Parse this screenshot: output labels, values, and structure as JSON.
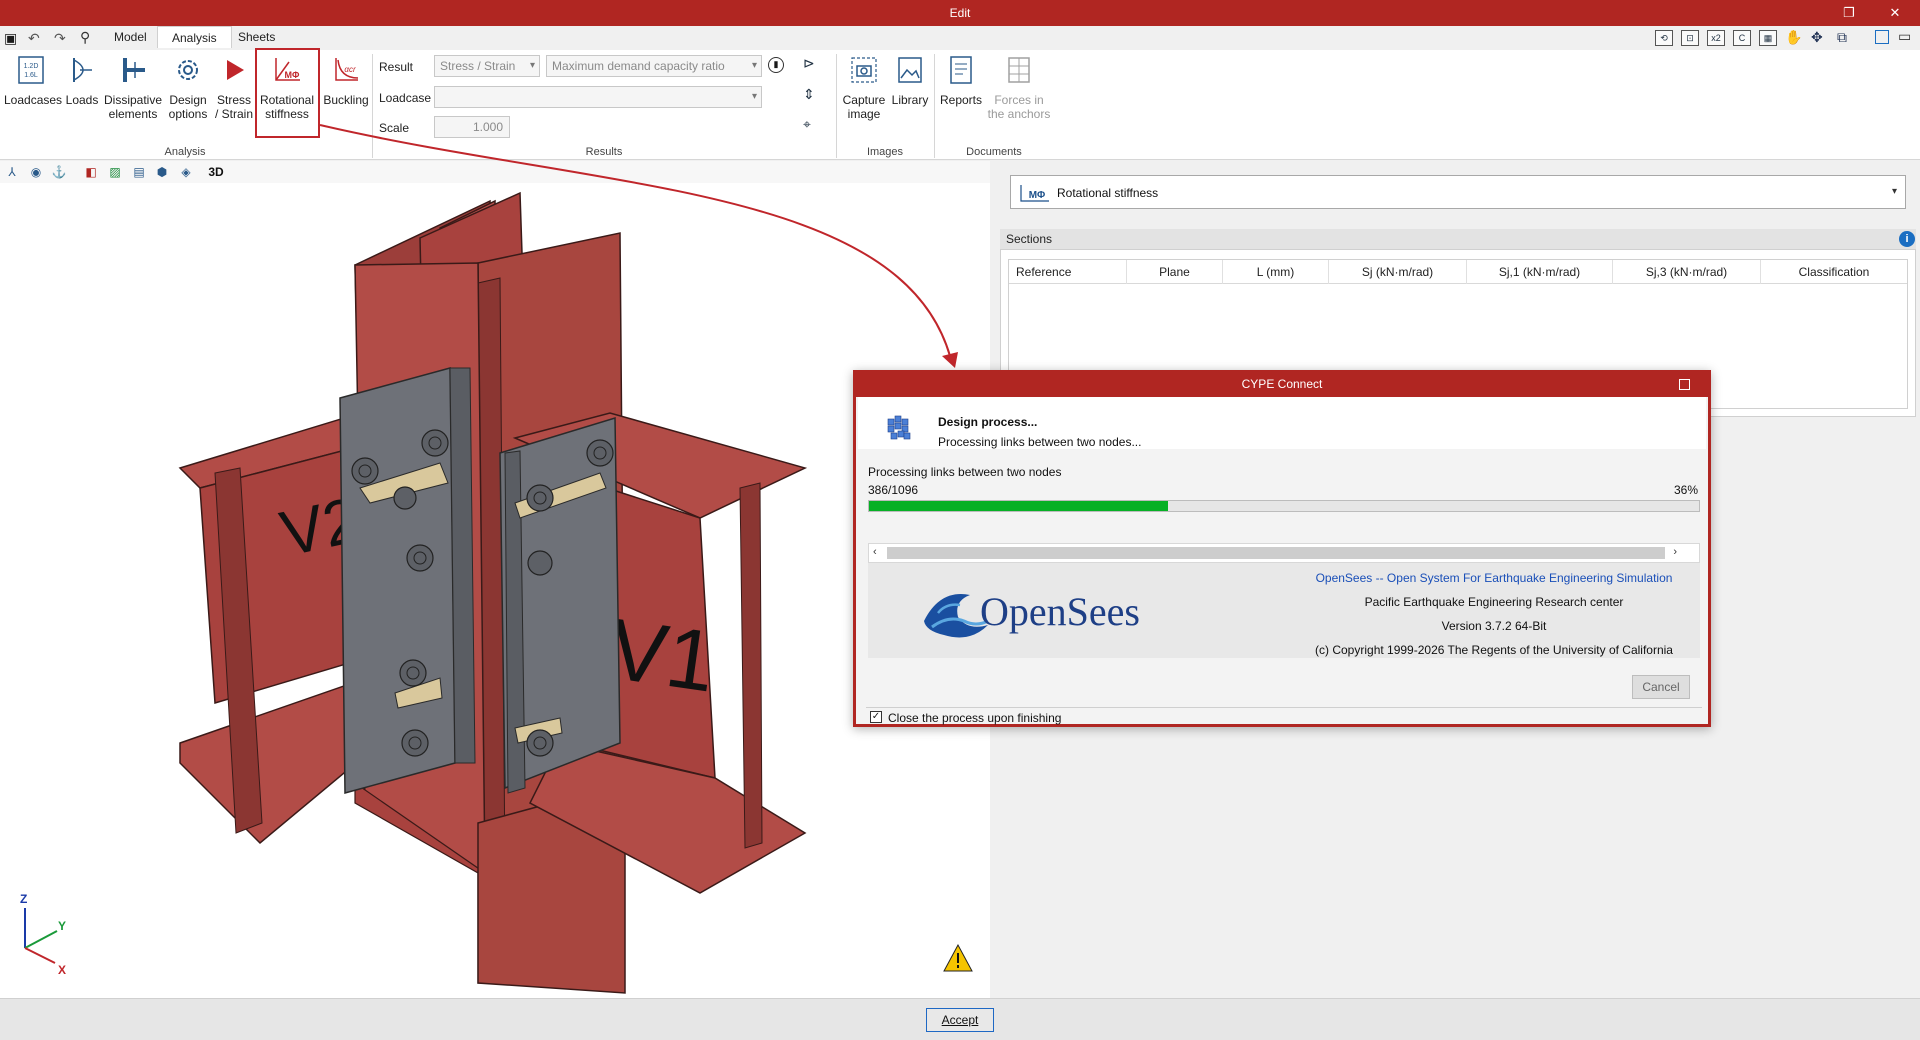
{
  "window": {
    "title": "Edit"
  },
  "tabs": [
    {
      "label": "Model"
    },
    {
      "label": "Analysis"
    },
    {
      "label": "Sheets"
    }
  ],
  "ribbon": {
    "analysis_group": {
      "label": "Analysis",
      "buttons": [
        {
          "label1": "Loadcases",
          "label2": ""
        },
        {
          "label1": "Loads",
          "label2": ""
        },
        {
          "label1": "Dissipative",
          "label2": "elements"
        },
        {
          "label1": "Design",
          "label2": "options"
        },
        {
          "label1": "Stress",
          "label2": "/ Strain"
        },
        {
          "label1": "Rotational",
          "label2": "stiffness"
        },
        {
          "label1": "Buckling",
          "label2": ""
        }
      ]
    },
    "results_group": {
      "label": "Results",
      "result_label": "Result",
      "result_value": "Stress / Strain",
      "result_mode": "Maximum demand capacity ratio",
      "loadcase_label": "Loadcase",
      "loadcase_value": "",
      "scale_label": "Scale",
      "scale_value": "1.000"
    },
    "images_group": {
      "label": "Images",
      "buttons": [
        {
          "label1": "Capture",
          "label2": "image"
        },
        {
          "label1": "Library",
          "label2": ""
        }
      ]
    },
    "documents_group": {
      "label": "Documents",
      "buttons": [
        {
          "label1": "Reports",
          "label2": ""
        },
        {
          "label1": "Forces in",
          "label2": "the anchors"
        }
      ]
    }
  },
  "viewport": {
    "beam_labels": [
      "V2",
      "V1"
    ],
    "axes": {
      "z": "Z",
      "y": "Y",
      "x": "X"
    },
    "toolbar_3d": "3D"
  },
  "right_panel": {
    "selector_value": "Rotational stiffness",
    "sections_title": "Sections",
    "columns": [
      "Reference",
      "Plane",
      "L (mm)",
      "Sj (kN·m/rad)",
      "Sj,1 (kN·m/rad)",
      "Sj,3 (kN·m/rad)",
      "Classification"
    ]
  },
  "dialog": {
    "title": "CYPE Connect",
    "heading": "Design process...",
    "subheading": "Processing links between two nodes...",
    "process_label": "Processing links between two nodes",
    "count": "386/1096",
    "percent_text": "36%",
    "progress_fraction": 0.36,
    "opensees": {
      "logo_text": "OpenSees",
      "line1": "OpenSees -- Open System For Earthquake Engineering Simulation",
      "line2": "Pacific Earthquake Engineering Research center",
      "line3": "Version 3.7.2 64-Bit",
      "line4": "(c) Copyright 1999-2026 The Regents of the University of California"
    },
    "cancel_label": "Cancel",
    "close_on_finish_label": "Close the process upon finishing",
    "close_on_finish_checked": true
  },
  "footer": {
    "accept_label": "Accept"
  },
  "colors": {
    "brand_red": "#b02622",
    "steel_red": "#a8423e",
    "plate_gray": "#6e7178",
    "progress_green": "#06b025"
  }
}
